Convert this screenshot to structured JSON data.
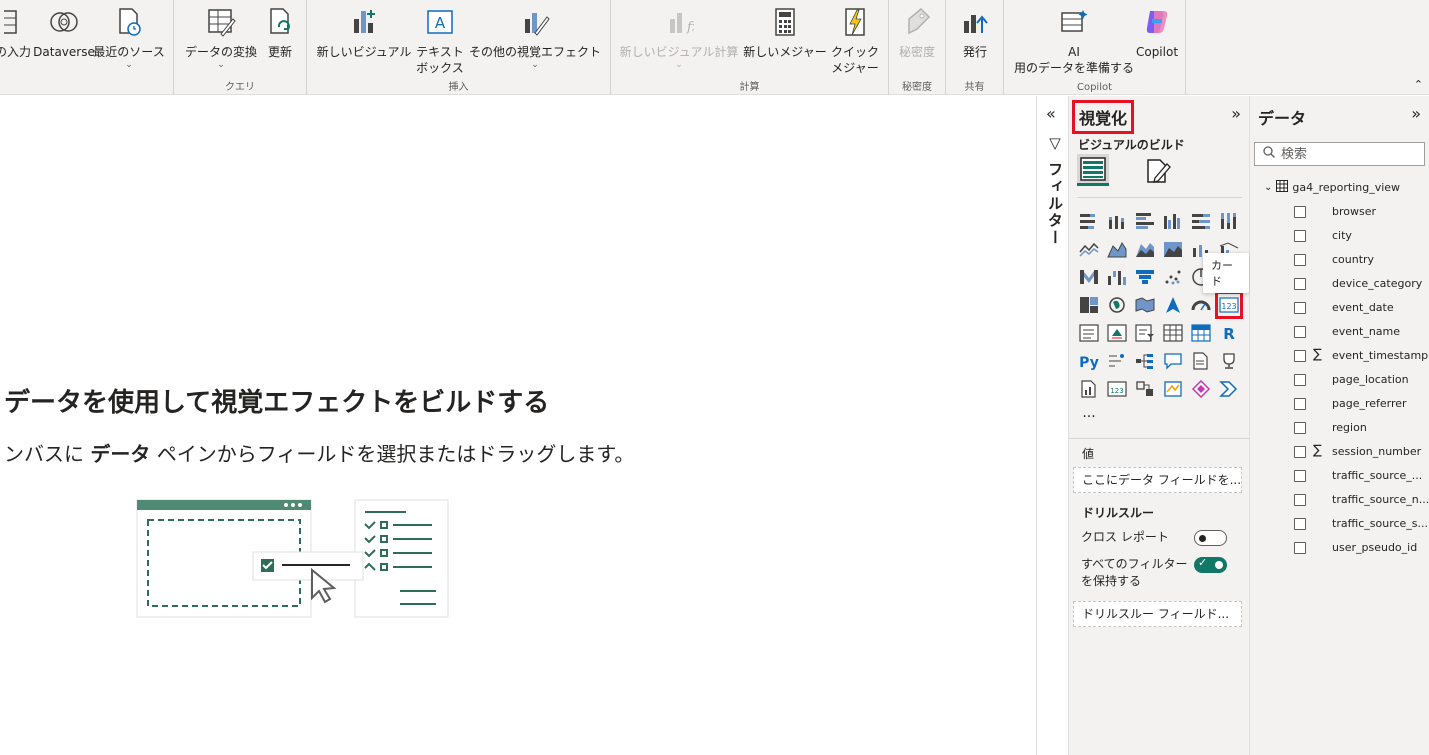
{
  "ribbon": {
    "groups": [
      {
        "label": ""
      },
      {
        "label": "クエリ"
      },
      {
        "label": "挿入"
      },
      {
        "label": "計算"
      },
      {
        "label": "秘密度"
      },
      {
        "label": "共有"
      },
      {
        "label": "Copilot"
      }
    ],
    "buttons": {
      "enter_data": "の入力",
      "dataverse": "Dataverse",
      "recent_sources": "最近のソース",
      "transform_data": "データの変換",
      "refresh": "更新",
      "new_visual": "新しいビジュアル",
      "text_box_line1": "テキスト",
      "text_box_line2": "ボックス",
      "more_visuals": "その他の視覚エフェクト",
      "new_visual_calc": "新しいビジュアル計算",
      "new_measure": "新しいメジャー",
      "quick_measure_line1": "クイック",
      "quick_measure_line2": "メジャー",
      "sensitivity": "秘密度",
      "publish": "発行",
      "ai_prep_line1": "AI",
      "ai_prep_line2": "用のデータを準備する",
      "copilot": "Copilot"
    }
  },
  "canvas": {
    "title": "データを使用して視覚エフェクトをビルドする",
    "subtitle_pre": "ンバスに ",
    "subtitle_bold": "データ",
    "subtitle_post": " ペインからフィールドを選択またはドラッグします。"
  },
  "filters": {
    "label": "フィルター"
  },
  "visualizations": {
    "title": "視覚化",
    "build_label": "ビジュアルのビルド",
    "tooltip": "カード",
    "values_label": "値",
    "values_placeholder": "ここにデータ フィールドを...",
    "drill_label": "ドリルスルー",
    "cross_report": "クロス レポート",
    "cross_report_state": "off",
    "keep_filters_line1": "すべてのフィルター",
    "keep_filters_line2": "を保持する",
    "keep_filters_state": "on",
    "drill_placeholder": "ドリルスルー フィールド...",
    "more": "···"
  },
  "data_pane": {
    "title": "データ",
    "search_placeholder": "検索",
    "table": "ga4_reporting_view",
    "fields": [
      {
        "name": "browser",
        "sigma": false
      },
      {
        "name": "city",
        "sigma": false
      },
      {
        "name": "country",
        "sigma": false
      },
      {
        "name": "device_category",
        "sigma": false
      },
      {
        "name": "event_date",
        "sigma": false
      },
      {
        "name": "event_name",
        "sigma": false
      },
      {
        "name": "event_timestamp",
        "sigma": true
      },
      {
        "name": "page_location",
        "sigma": false
      },
      {
        "name": "page_referrer",
        "sigma": false
      },
      {
        "name": "region",
        "sigma": false
      },
      {
        "name": "session_number",
        "sigma": true
      },
      {
        "name": "traffic_source_...",
        "sigma": false
      },
      {
        "name": "traffic_source_n...",
        "sigma": false
      },
      {
        "name": "traffic_source_s...",
        "sigma": false
      },
      {
        "name": "user_pseudo_id",
        "sigma": false
      }
    ]
  },
  "colors": {
    "accent": "#117865",
    "highlight": "#e81123",
    "pane_bg": "#f3f2f1"
  }
}
